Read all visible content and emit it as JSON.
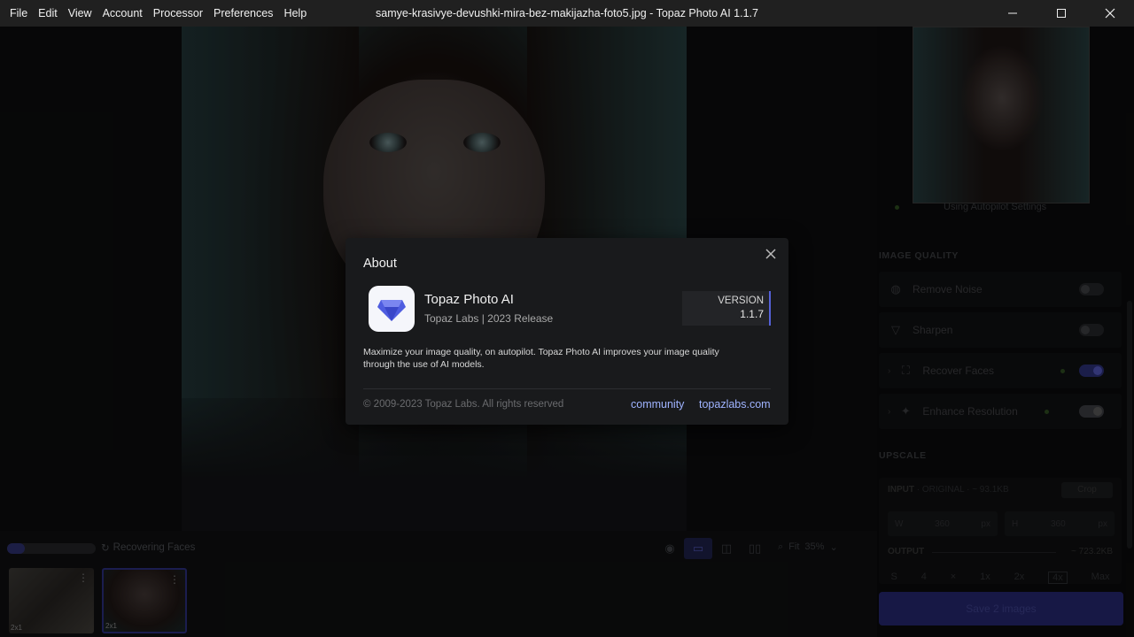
{
  "menubar": {
    "items": [
      "File",
      "Edit",
      "View",
      "Account",
      "Processor",
      "Preferences",
      "Help"
    ]
  },
  "window": {
    "title": "samye-krasivye-devushki-mira-bez-makijazha-foto5.jpg - Topaz Photo AI 1.1.7"
  },
  "bottom": {
    "status": "Recovering Faces",
    "zoom_label": "Fit",
    "zoom_value": "35%",
    "progress": 0.2,
    "thumbs": [
      {
        "meta": "2x1"
      },
      {
        "meta": "2x1"
      }
    ]
  },
  "panel": {
    "autopilot": "Using Autopilot Settings",
    "image_quality_header": "IMAGE QUALITY",
    "rows": [
      {
        "label": "Remove Noise",
        "icon": "remove-noise-icon"
      },
      {
        "label": "Sharpen",
        "icon": "sharpen-icon"
      },
      {
        "label": "Recover Faces",
        "icon": "recover-faces-icon"
      },
      {
        "label": "Enhance Resolution",
        "icon": "enhance-resolution-icon"
      }
    ],
    "upscale_header": "UPSCALE",
    "input_label": "INPUT",
    "input_sub": "· ORIGINAL · ~ 93.1KB",
    "crop": "Crop",
    "width": "360",
    "height": "360",
    "unit": "px",
    "w_letter": "W",
    "h_letter": "H",
    "output_label": "OUTPUT",
    "output_size": "~ 723.2KB",
    "scales": [
      "S",
      "4",
      "×",
      "1x",
      "2x",
      "4x",
      "Max"
    ],
    "save_label": "Save 2 images"
  },
  "dialog": {
    "title": "About",
    "app_name": "Topaz Photo AI",
    "app_sub": "Topaz Labs | 2023 Release",
    "version_label": "VERSION",
    "version": "1.1.7",
    "description": "Maximize your image quality, on autopilot. Topaz Photo AI improves your image quality through the use of AI models.",
    "copyright": "© 2009-2023 Topaz Labs. All rights reserved",
    "link_community": "community",
    "link_site": "topazlabs.com"
  },
  "colors": {
    "accent": "#5561d8",
    "link": "#9fb3ff",
    "dialog_bg": "#191a1c"
  }
}
